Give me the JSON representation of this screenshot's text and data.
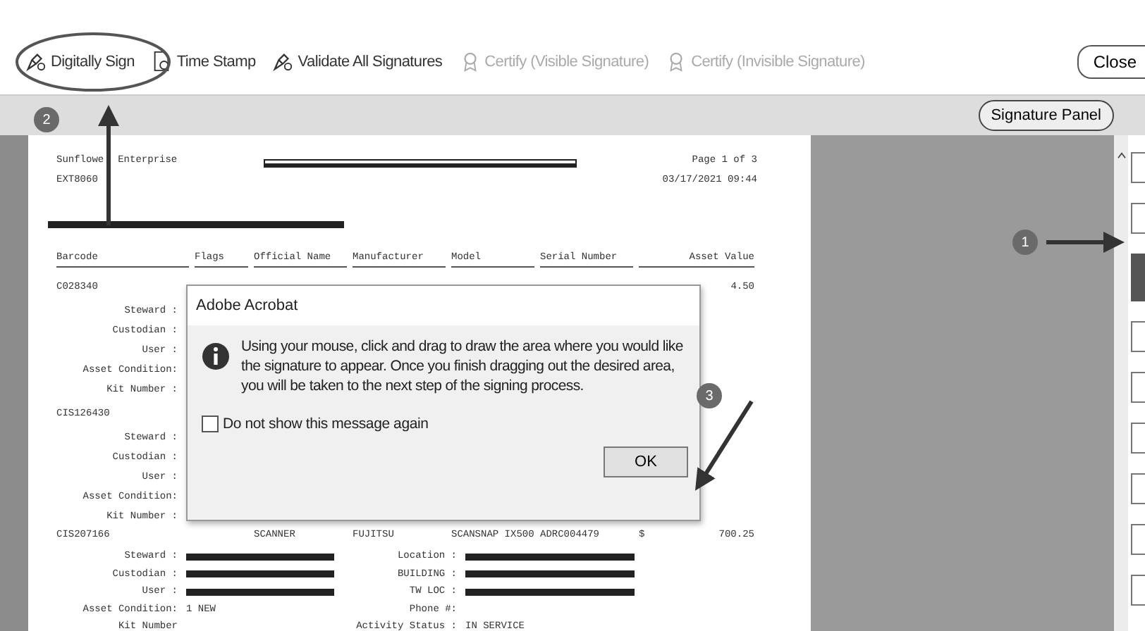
{
  "toolbar": {
    "tools": [
      {
        "label": "Digitally Sign",
        "disabled": false
      },
      {
        "label": "Time Stamp",
        "disabled": false
      },
      {
        "label": "Validate All Signatures",
        "disabled": false
      },
      {
        "label": "Certify (Visible Signature)",
        "disabled": true
      },
      {
        "label": "Certify (Invisible Signature)",
        "disabled": true
      }
    ],
    "close_button": "Close"
  },
  "signature_panel_button": "Signature Panel",
  "annotations": [
    {
      "label": "2"
    },
    {
      "label": "1"
    },
    {
      "label": "3"
    }
  ],
  "document": {
    "company": [
      "Sunflowe",
      "Enterprise"
    ],
    "code": "EXT8060",
    "page": "Page 1 of 3",
    "timestamp": "03/17/2021 09:44",
    "columns": [
      "Barcode",
      "Flags",
      "Official Name",
      "Manufacturer",
      "Model",
      "Serial Number",
      "Asset Value"
    ],
    "rows": [
      {
        "cells": [
          "C028340",
          "",
          "",
          "",
          "",
          "",
          ""
        ],
        "currency": "",
        "value": "4.50",
        "details": [
          {
            "left": {
              "label": "Steward :"
            }
          },
          {
            "left": {
              "label": "Custodian :"
            }
          },
          {
            "left": {
              "label": "User :"
            }
          },
          {
            "left": {
              "label": "Asset Condition:"
            }
          },
          {
            "left": {
              "label": "Kit Number :"
            }
          }
        ]
      },
      {
        "cells": [
          "CIS126430",
          "",
          "",
          "",
          "",
          "",
          ""
        ],
        "currency": "",
        "value": "",
        "details": [
          {
            "left": {
              "label": "Steward :"
            }
          },
          {
            "left": {
              "label": "Custodian :"
            }
          },
          {
            "left": {
              "label": "User :"
            }
          },
          {
            "left": {
              "label": "Asset Condition:"
            }
          },
          {
            "left": {
              "label": "Kit Number :"
            }
          }
        ]
      },
      {
        "cells": [
          "CIS207166",
          "",
          "SCANNER",
          "FUJITSU",
          "SCANSNAP IX500",
          "ADRC004479"
        ],
        "currency": "$",
        "value": "700.25",
        "details": [
          {
            "left": {
              "label": "Steward :",
              "redacted": true
            },
            "right": {
              "label": "Location :",
              "redacted": true
            }
          },
          {
            "left": {
              "label": "Custodian :",
              "redacted": true
            },
            "right": {
              "label": "BUILDING :",
              "redacted": true
            }
          },
          {
            "left": {
              "label": "User :",
              "redacted": true
            },
            "right": {
              "label": "TW LOC :",
              "redacted": true
            }
          },
          {
            "left": {
              "label": "Asset Condition:",
              "value": "1 NEW"
            },
            "right": {
              "label": "Phone #:"
            }
          },
          {
            "left": {
              "label": "Kit Number"
            },
            "right": {
              "label": "Activity Status :",
              "value": "IN SERVICE"
            }
          }
        ]
      }
    ]
  },
  "dialog": {
    "title": "Adobe Acrobat",
    "message": "Using your mouse, click and drag to draw the area where you would like the signature to appear. Once you finish dragging out the desired area, you will be taken to the next step of the signing process.",
    "checkbox": {
      "label": "Do not show this message again",
      "checked": false
    },
    "ok_button": "OK"
  },
  "right_tools": [
    {
      "selected": false
    },
    {
      "selected": false
    },
    {
      "selected": true
    },
    {
      "selected": false
    },
    {
      "selected": false
    },
    {
      "selected": false
    },
    {
      "selected": false
    },
    {
      "selected": false
    },
    {
      "selected": false
    }
  ]
}
